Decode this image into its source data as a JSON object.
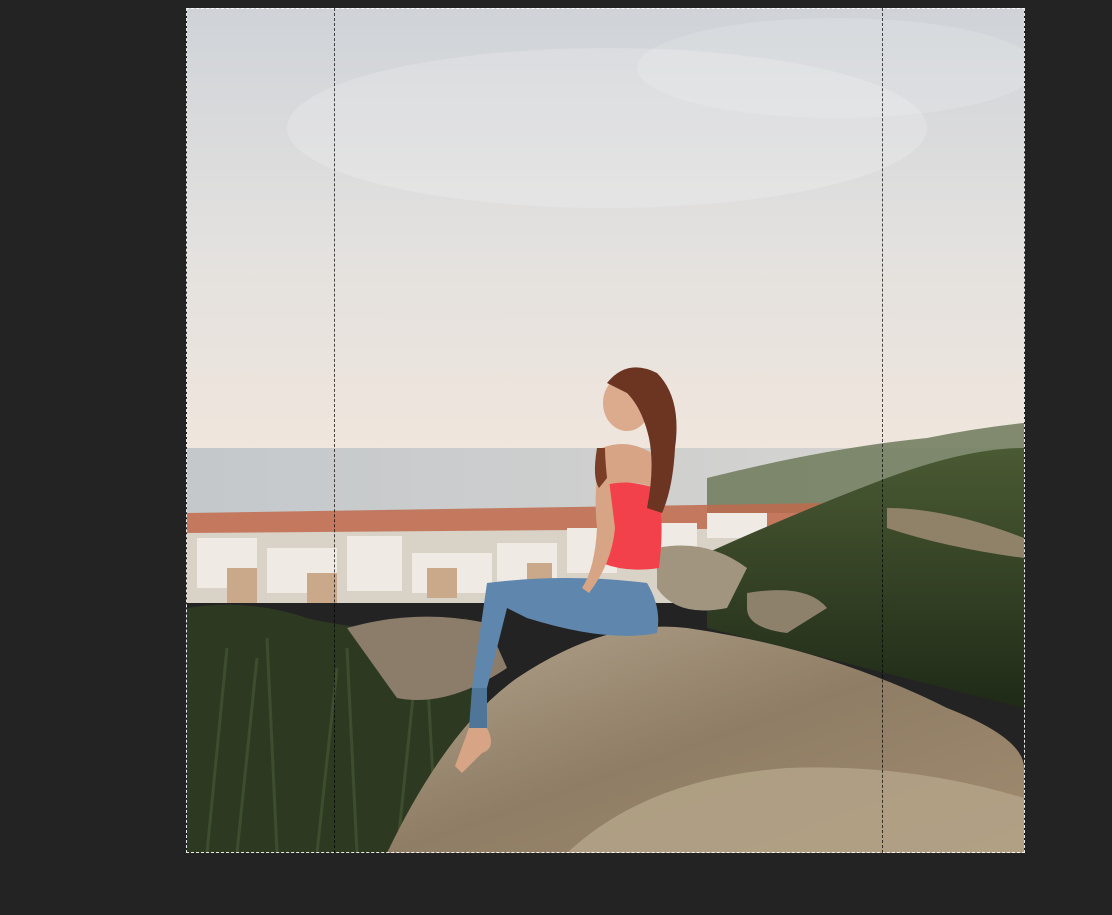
{
  "app": {
    "canvas_background": "#232323"
  },
  "document": {
    "content": "photo",
    "icon": "image-icon",
    "colors": {
      "sky_top": "#d2d5d8",
      "sky_bottom": "#efe6dd",
      "sea": "#c9ccce",
      "town": "#e9e3da",
      "rooftops": "#c06a4c",
      "vegetation": "#2f3d22",
      "rock": "#9c8a72",
      "top": "#f3414b",
      "jeans": "#5f86ad",
      "hair": "#6b3522",
      "skin": "#d8a486"
    }
  },
  "selection": {
    "style": "marching-ants",
    "guides_count": 2
  }
}
